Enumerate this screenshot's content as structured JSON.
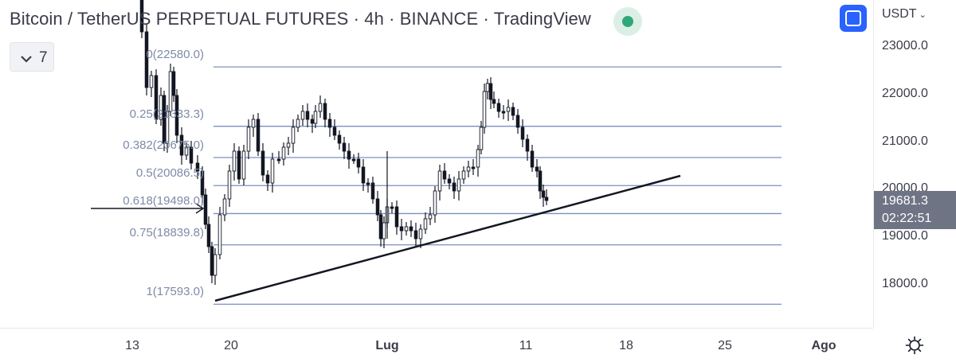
{
  "header": {
    "title": "Bitcoin / TetherUS PERPETUAL FUTURES · 4h · BINANCE · TradingView",
    "indicators_count": "7"
  },
  "price_scale": {
    "currency": "USDT",
    "ticks": [
      "23000.0",
      "22000.0",
      "21000.0",
      "20000.0",
      "19000.0",
      "18000.0"
    ],
    "tick_values": [
      23000,
      22000,
      21000,
      20000,
      19000,
      18000
    ],
    "current_price": "19681.3",
    "countdown": "02:22:51"
  },
  "time_axis": {
    "labels": [
      {
        "text": "13",
        "bold": false
      },
      {
        "text": "20",
        "bold": false
      },
      {
        "text": "Lug",
        "bold": true
      },
      {
        "text": "11",
        "bold": false
      },
      {
        "text": "18",
        "bold": false
      },
      {
        "text": "25",
        "bold": false
      },
      {
        "text": "Ago",
        "bold": true
      }
    ]
  },
  "fibonacci": {
    "levels": [
      {
        "label": "0(22580.0)",
        "price": 22580.0
      },
      {
        "label": "0.25(21333.3)",
        "price": 21333.3
      },
      {
        "label": "0.382(20675.0)",
        "price": 20675.0
      },
      {
        "label": "0.5(20086.5)",
        "price": 20086.5
      },
      {
        "label": "0.618(19498.0)",
        "price": 19498.0
      },
      {
        "label": "0.75(18839.8)",
        "price": 18839.8
      },
      {
        "label": "1(17593.0)",
        "price": 17593.0
      }
    ]
  },
  "colors": {
    "fib_line": "#7b8fc0",
    "candles": "#131722",
    "trendline": "#131722",
    "accent": "#2962ff",
    "live": "#2ea87a",
    "badge": "#6f7485"
  },
  "icons": {
    "collapse": "chevron-down-icon",
    "fullscreen": "fullscreen-icon",
    "live": "live-status-icon",
    "settings": "gear-icon"
  }
}
